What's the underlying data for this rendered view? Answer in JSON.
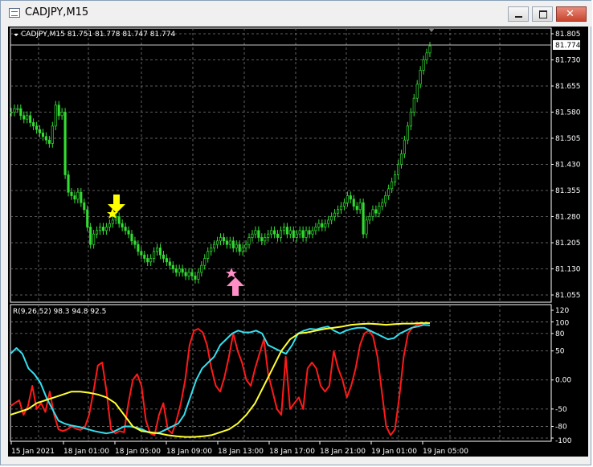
{
  "window": {
    "title": "CADJPY,M15",
    "min_icon": "minimize-icon",
    "max_icon": "maximize-icon",
    "close_icon": "close-icon"
  },
  "main": {
    "header": "CADJPY,M15  81.751 81.778 81.747 81.774",
    "current_price": "81.774",
    "price_ticks": [
      "81.805",
      "81.730",
      "81.655",
      "81.580",
      "81.505",
      "81.430",
      "81.355",
      "81.280",
      "81.205",
      "81.130",
      "81.055"
    ],
    "sell_arrow_color": "#ffff00",
    "buy_arrow_color": "#ff8ec7"
  },
  "indicator": {
    "header": "R(9,26,52) 98.3 94.8 92.5",
    "ticks": [
      "120",
      "100",
      "80",
      "50",
      "0.00",
      "-50",
      "-80",
      "-100"
    ],
    "series_colors": [
      "#ff1a1a",
      "#33e0f0",
      "#ffff33"
    ]
  },
  "time_axis": [
    "15 Jan 2021",
    "18 Jan 01:00",
    "18 Jan 05:00",
    "18 Jan 09:00",
    "18 Jan 13:00",
    "18 Jan 17:00",
    "18 Jan 21:00",
    "19 Jan 01:00",
    "19 Jan 05:00"
  ],
  "chart_data": [
    {
      "type": "line",
      "title": "CADJPY,M15",
      "ylim": [
        81.055,
        81.805
      ],
      "x_labels": [
        "15 Jan 2021",
        "18 Jan 01:00",
        "18 Jan 05:00",
        "18 Jan 09:00",
        "18 Jan 13:00",
        "18 Jan 17:00",
        "18 Jan 21:00",
        "19 Jan 01:00",
        "19 Jan 05:00"
      ],
      "series": [
        {
          "values": [
            81.58,
            81.59,
            81.59,
            81.57,
            81.56,
            81.57,
            81.55,
            81.54,
            81.53,
            81.52,
            81.51,
            81.5,
            81.49,
            81.54,
            81.6,
            81.57,
            81.58,
            81.4,
            81.35,
            81.34,
            81.33,
            81.35,
            81.32,
            81.3,
            81.25,
            81.2,
            81.23,
            81.24,
            81.25,
            81.24,
            81.25,
            81.26,
            81.27,
            81.28,
            81.26,
            81.25,
            81.24,
            81.23,
            81.21,
            81.2,
            81.18,
            81.17,
            81.16,
            81.15,
            81.16,
            81.18,
            81.19,
            81.17,
            81.16,
            81.15,
            81.14,
            81.13,
            81.12,
            81.13,
            81.12,
            81.11,
            81.12,
            81.11,
            81.1,
            81.12,
            81.14,
            81.16,
            81.18,
            81.19,
            81.2,
            81.21,
            81.22,
            81.21,
            81.2,
            81.21,
            81.19,
            81.2,
            81.18,
            81.19,
            81.2,
            81.22,
            81.23,
            81.24,
            81.22,
            81.21,
            81.22,
            81.23,
            81.24,
            81.23,
            81.22,
            81.24,
            81.25,
            81.23,
            81.24,
            81.22,
            81.23,
            81.24,
            81.22,
            81.24,
            81.23,
            81.24,
            81.25,
            81.26,
            81.25,
            81.26,
            81.27,
            81.28,
            81.29,
            81.3,
            81.31,
            81.32,
            81.34,
            81.33,
            81.31,
            81.3,
            81.32,
            81.23,
            81.27,
            81.28,
            81.3,
            81.29,
            81.31,
            81.32,
            81.34,
            81.36,
            81.38,
            81.4,
            81.43,
            81.46,
            81.5,
            81.54,
            81.58,
            81.62,
            81.66,
            81.7,
            81.73,
            81.75,
            81.77
          ]
        }
      ]
    },
    {
      "type": "line",
      "title": "R(9,26,52) 98.3 94.8 92.5",
      "ylim": [
        -100,
        120
      ],
      "x_labels": [
        "15 Jan 2021",
        "18 Jan 01:00",
        "18 Jan 05:00",
        "18 Jan 09:00",
        "18 Jan 13:00",
        "18 Jan 17:00",
        "18 Jan 21:00",
        "19 Jan 01:00",
        "19 Jan 05:00"
      ],
      "series": [
        {
          "values": [
            -45,
            -40,
            -35,
            -60,
            -45,
            -10,
            -50,
            -40,
            -55,
            -20,
            -60,
            -85,
            -88,
            -85,
            -80,
            -84,
            -86,
            -82,
            -60,
            -20,
            25,
            30,
            -20,
            -85,
            -92,
            -88,
            -90,
            -40,
            0,
            10,
            -10,
            -70,
            -92,
            -95,
            -60,
            -40,
            -85,
            -92,
            -70,
            -40,
            0,
            60,
            85,
            88,
            82,
            60,
            20,
            -10,
            -20,
            5,
            40,
            80,
            50,
            30,
            0,
            -10,
            20,
            45,
            70,
            10,
            -20,
            -50,
            -60,
            40,
            -50,
            -40,
            -30,
            -50,
            20,
            30,
            20,
            -10,
            -20,
            -10,
            50,
            20,
            0,
            -30,
            -10,
            20,
            60,
            80,
            85,
            75,
            40,
            -20,
            -80,
            -95,
            -85,
            -30,
            40,
            80,
            90,
            95,
            97,
            98,
            98
          ]
        },
        {
          "values": [
            45,
            55,
            45,
            20,
            10,
            -5,
            -30,
            -50,
            -70,
            -75,
            -78,
            -80,
            -82,
            -85,
            -88,
            -90,
            -92,
            -90,
            -85,
            -80,
            -80,
            -82,
            -85,
            -90,
            -92,
            -90,
            -85,
            -80,
            -75,
            -60,
            -30,
            0,
            20,
            30,
            40,
            60,
            70,
            80,
            85,
            82,
            82,
            85,
            80,
            60,
            55,
            50,
            45,
            60,
            80,
            85,
            88,
            87,
            90,
            92,
            85,
            80,
            85,
            88,
            90,
            90,
            85,
            80,
            75,
            70,
            72,
            80,
            85,
            90,
            92,
            95,
            94
          ]
        },
        {
          "values": [
            -60,
            -55,
            -50,
            -40,
            -35,
            -30,
            -25,
            -20,
            -20,
            -22,
            -25,
            -30,
            -40,
            -60,
            -80,
            -88,
            -90,
            -92,
            -95,
            -97,
            -98,
            -98,
            -97,
            -95,
            -90,
            -85,
            -75,
            -60,
            -40,
            -10,
            20,
            50,
            70,
            80,
            82,
            85,
            88,
            90,
            92,
            95,
            96,
            97,
            96,
            95,
            96,
            97,
            97,
            98,
            98
          ]
        }
      ]
    }
  ]
}
